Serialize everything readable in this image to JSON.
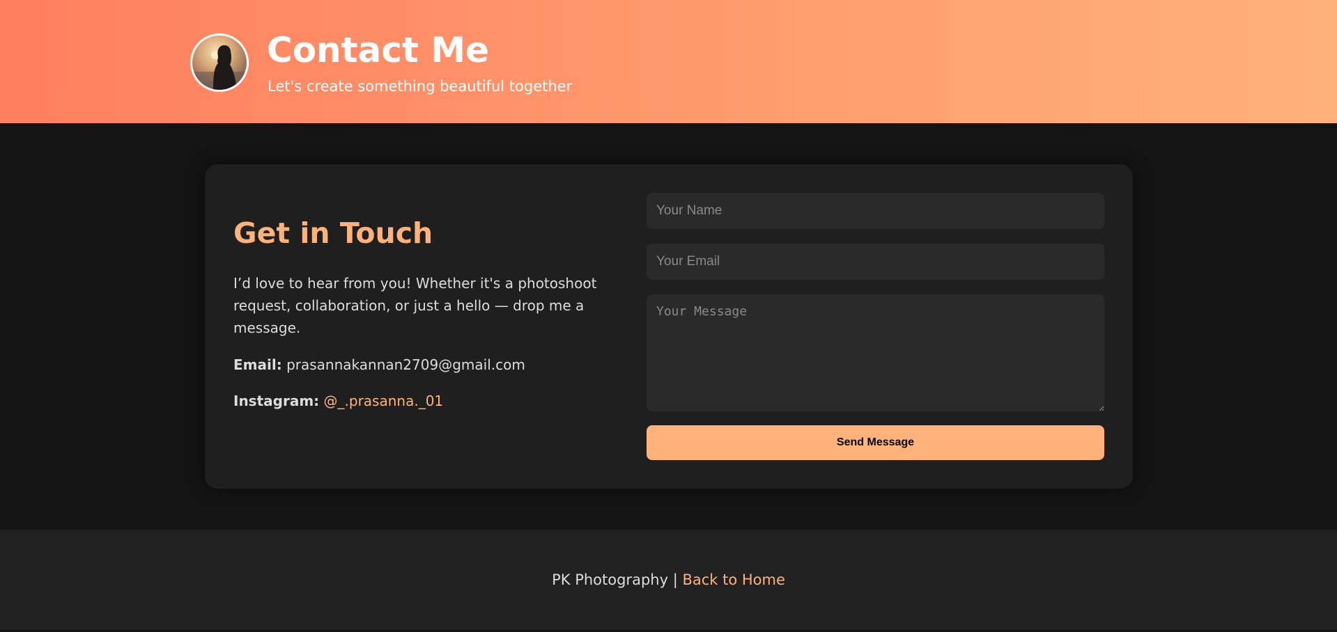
{
  "header": {
    "title": "Contact Me",
    "subtitle": "Let's create something beautiful together",
    "avatar_icon": "portrait-silhouette-sunset"
  },
  "contact_info": {
    "heading": "Get in Touch",
    "intro": "I’d love to hear from you! Whether it's a photoshoot request, collaboration, or just a hello — drop me a message.",
    "email_label": "Email:",
    "email_value": "prasannakannan2709@gmail.com",
    "instagram_label": "Instagram:",
    "instagram_handle": "@_.prasanna._01"
  },
  "form": {
    "name_placeholder": "Your Name",
    "email_placeholder": "Your Email",
    "message_placeholder": "Your Message",
    "submit_label": "Send Message"
  },
  "footer": {
    "brand": "PK Photography",
    "separator": "|",
    "home_link": "Back to Home"
  },
  "colors": {
    "header_gradient_start": "#ff7f5e",
    "header_gradient_end": "#ffb27a",
    "accent": "#ffb37a",
    "background": "#141414",
    "card": "#1f1f1f",
    "input_bg": "#2a2a2a"
  }
}
